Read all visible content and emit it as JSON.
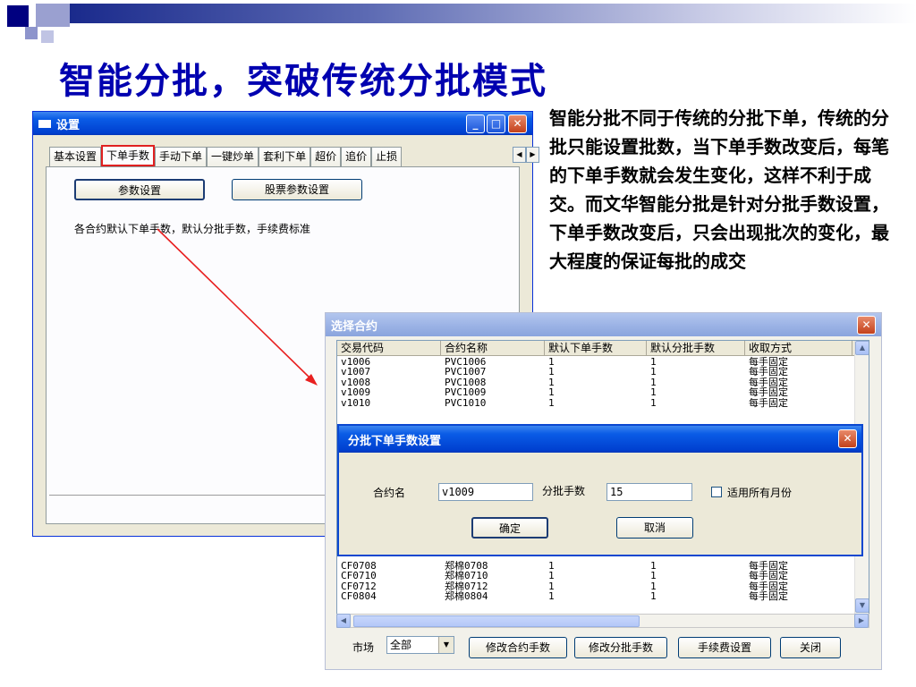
{
  "slide": {
    "title": "智能分批，突破传统分批模式",
    "description": "智能分批不同于传统的分批下单，传统的分批只能设置批数，当下单手数改变后，每笔的下单手数就会发生变化，这样不利于成交。而文华智能分批是针对分批手数设置，下单手数改变后，只会出现批次的变化，最大程度的保证每批的成交"
  },
  "settings_window": {
    "title": "设置",
    "tabs": [
      "基本设置",
      "下单手数",
      "手动下单",
      "一键炒单",
      "套利下单",
      "超价",
      "追价",
      "止损"
    ],
    "active_tab": "下单手数",
    "param_button": "参数设置",
    "stock_param_button": "股票参数设置",
    "hint": "各合约默认下单手数，默认分批手数，手续费标准"
  },
  "select_contract_window": {
    "title": "选择合约",
    "columns": [
      "交易代码",
      "合约名称",
      "默认下单手数",
      "默认分批手数",
      "收取方式"
    ],
    "rows_top": [
      [
        "v1006",
        "PVC1006",
        "1",
        "1",
        "每手固定"
      ],
      [
        "v1007",
        "PVC1007",
        "1",
        "1",
        "每手固定"
      ],
      [
        "v1008",
        "PVC1008",
        "1",
        "1",
        "每手固定"
      ],
      [
        "v1009",
        "PVC1009",
        "1",
        "1",
        "每手固定"
      ],
      [
        "v1010",
        "PVC1010",
        "1",
        "1",
        "每手固定"
      ]
    ],
    "rows_bottom": [
      [
        "CF0708",
        "郑棉0708",
        "1",
        "1",
        "每手固定"
      ],
      [
        "CF0710",
        "郑棉0710",
        "1",
        "1",
        "每手固定"
      ],
      [
        "CF0712",
        "郑棉0712",
        "1",
        "1",
        "每手固定"
      ],
      [
        "CF0804",
        "郑棉0804",
        "1",
        "1",
        "每手固定"
      ]
    ],
    "market_label": "市场",
    "market_value": "全部",
    "buttons": {
      "modify_contract_lots": "修改合约手数",
      "modify_split_lots": "修改分批手数",
      "fee_settings": "手续费设置",
      "close": "关闭"
    }
  },
  "split_dialog": {
    "title": "分批下单手数设置",
    "contract_label": "合约名",
    "contract_value": "v1009",
    "split_label": "分批手数",
    "split_value": "15",
    "apply_all_label": "适用所有月份",
    "confirm": "确定",
    "cancel": "取消"
  },
  "colors": {
    "title_blue": "#0000b0",
    "highlight_red": "#e02020",
    "xp_titlebar": "#0a5ce6"
  }
}
